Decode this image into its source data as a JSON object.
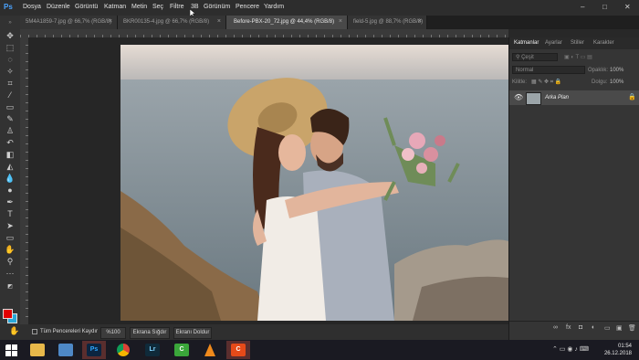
{
  "menubar": {
    "app_logo": "Ps",
    "items": [
      "Dosya",
      "Düzenle",
      "Görüntü",
      "Katman",
      "Metin",
      "Seç",
      "Filtre",
      "3B",
      "Görünüm",
      "Pencere",
      "Yardım"
    ],
    "window_buttons": [
      "–",
      "□",
      "✕"
    ]
  },
  "tabs": [
    {
      "label": "5M4A1859-7.jpg @ 66,7% (RGB/8)",
      "close": "×"
    },
    {
      "label": "BKR00135-4.jpg @ 66,7% (RGB/8)",
      "close": "×"
    },
    {
      "label": "Before-PBX-20_72.jpg @ 44,4% (RGB/8)",
      "close": "×"
    },
    {
      "label": "field-5.jpg @ 88,7% (RGB/8)",
      "close": "×"
    }
  ],
  "statusbar": {
    "hand_icon": "✋",
    "scroll_all_label": "Tüm Pencereleri Kaydır",
    "zoom_value": "%100",
    "fit_screen": "Ekrana Sığdır",
    "fill_screen": "Ekranı Doldur"
  },
  "panel": {
    "tabs": [
      "Katmanlar",
      "Ayarlar",
      "Stiller",
      "Karakter"
    ],
    "filter_placeholder": "Çeşit",
    "blend_mode": "Normal",
    "opacity_label": "Opaklık:",
    "opacity_value": "100%",
    "lock_label": "Kilitle:",
    "fill_label": "Dolgu:",
    "fill_value": "100%",
    "layer_name": "Arka Plan"
  },
  "taskbar": {
    "apps": [
      "Start",
      "File Explorer",
      "Network",
      "Photoshop",
      "Chrome",
      "Lightroom",
      "Camtasia",
      "VLC",
      "Camtasia Recorder"
    ],
    "time": "01:54",
    "date": "26.12.2018"
  },
  "colors": {
    "foreground": "#e10000",
    "background": "#2aa7d8"
  }
}
